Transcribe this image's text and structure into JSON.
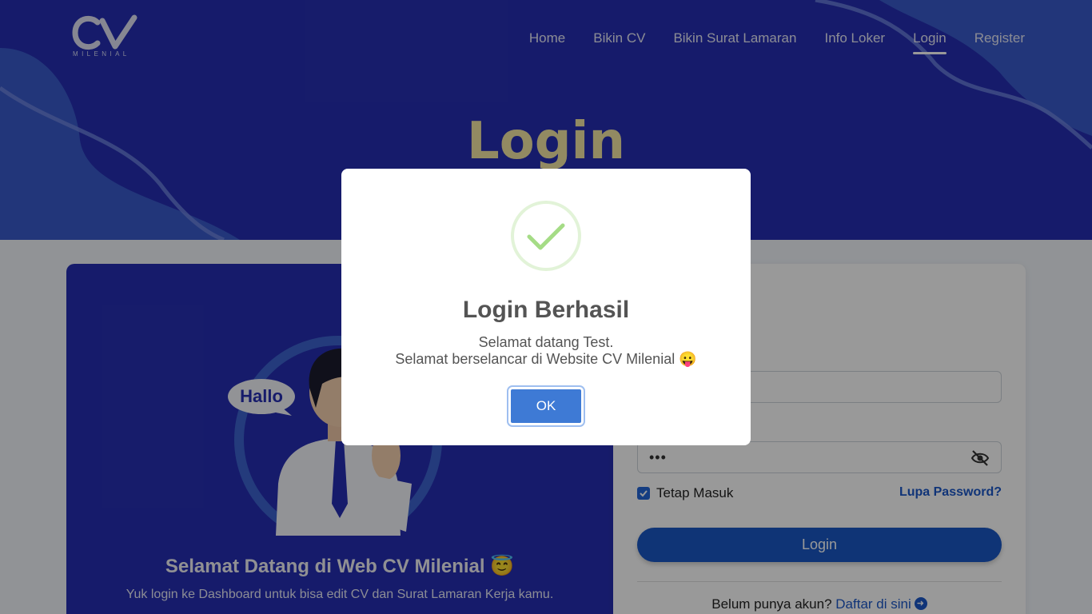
{
  "brand": {
    "logo_mark": "CV",
    "logo_text": "MILENIAL"
  },
  "nav": {
    "items": [
      {
        "label": "Home"
      },
      {
        "label": "Bikin CV"
      },
      {
        "label": "Bikin Surat Lamaran"
      },
      {
        "label": "Info Loker"
      },
      {
        "label": "Login",
        "active": true
      },
      {
        "label": "Register"
      }
    ]
  },
  "hero": {
    "title": "Login"
  },
  "welcome": {
    "bubble": "Hallo",
    "title": "Selamat Datang di Web CV Milenial 😇",
    "subtitle": "Yuk login ke Dashboard untuk bisa edit CV dan Surat Lamaran Kerja kamu."
  },
  "form": {
    "email_value": "",
    "password_value": "•••",
    "remember_label": "Tetap Masuk",
    "remember_checked": true,
    "forgot_label": "Lupa Password?",
    "login_label": "Login",
    "register_prompt": "Belum punya akun?",
    "register_link": "Daftar di sini"
  },
  "modal": {
    "title": "Login Berhasil",
    "line1": "Selamat datang Test.",
    "line2": "Selamat berselancar di Website CV Milenial 😛",
    "ok_label": "OK"
  },
  "colors": {
    "hero_bg": "#262eb3",
    "hero_title": "#f4e7a4",
    "primary_button": "#1a58c5",
    "success_green": "#a5dc86",
    "ok_button": "#3e7ad5"
  }
}
